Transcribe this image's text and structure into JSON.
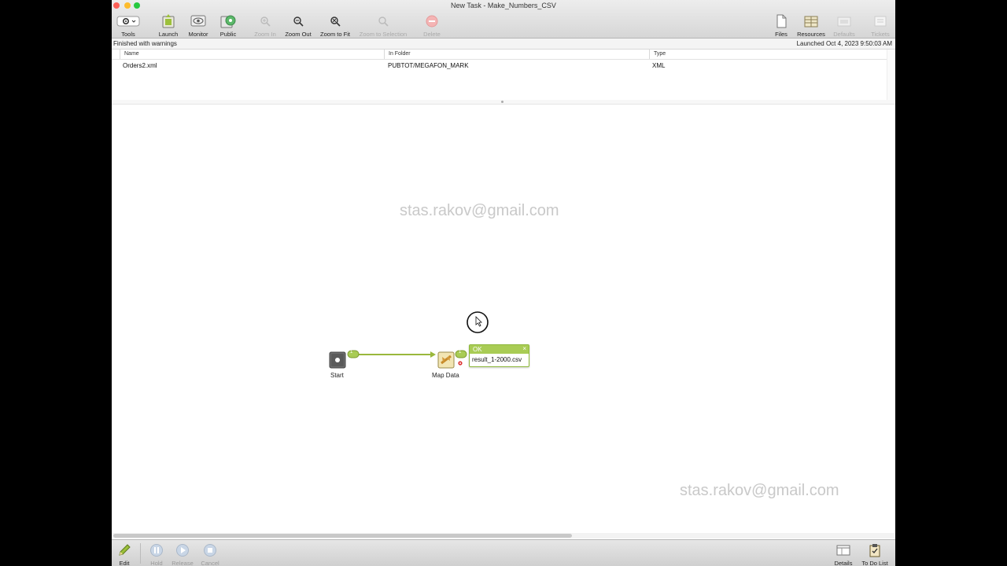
{
  "window": {
    "title": "New Task - Make_Numbers_CSV"
  },
  "toolbar": {
    "tools": "Tools",
    "launch": "Launch",
    "monitor": "Monitor",
    "public": "Public",
    "zoom_in": "Zoom In",
    "zoom_out": "Zoom Out",
    "zoom_to_fit": "Zoom to Fit",
    "zoom_to_selection": "Zoom to Selection",
    "delete": "Delete",
    "files": "Files",
    "resources": "Resources",
    "defaults": "Defaults",
    "tickets": "Tickets"
  },
  "status": {
    "left": "Finished with warnings",
    "right": "Launched Oct 4, 2023 9:50:03 AM"
  },
  "table": {
    "columns": [
      "Name",
      "In Folder",
      "Type"
    ],
    "rows": [
      {
        "name": "Orders2.xml",
        "folder": "PUBTOT/MEGAFON_MARK",
        "type": "XML"
      }
    ]
  },
  "canvas": {
    "watermark": "stas.rakov@gmail.com",
    "watermark2": "stas.rakov@gmail.com",
    "nodes": {
      "start": "Start",
      "map_data": "Map Data"
    },
    "link_badge_in": "1",
    "link_badge_out": "1",
    "popup": {
      "status": "OK",
      "close": "×",
      "file": "result_1-2000.csv"
    }
  },
  "bottombar": {
    "edit": "Edit",
    "hold": "Hold",
    "release": "Release",
    "cancel": "Cancel",
    "details": "Details",
    "todo": "To Do List"
  },
  "colors": {
    "accent_green": "#a9cc55",
    "link_green": "#9ab83c",
    "close_red": "#fc5f57",
    "minimize_yellow": "#fdbc2e",
    "zoom_green": "#28c840"
  }
}
